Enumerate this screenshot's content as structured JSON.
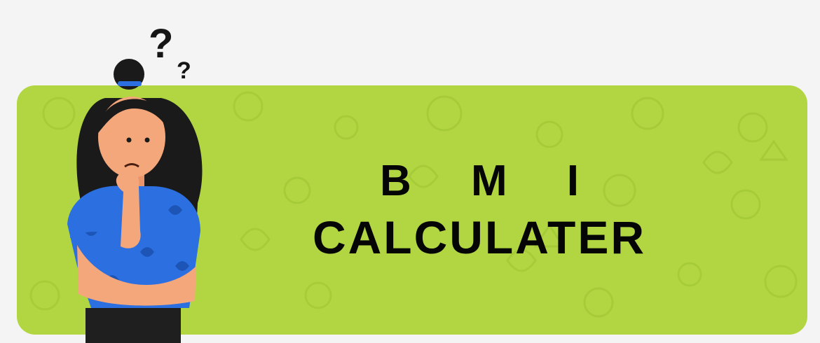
{
  "heading": {
    "line1": "B M I",
    "line2": "CALCULATER"
  },
  "colors": {
    "page_background": "#f4f4f4",
    "banner_background": "#b2d641",
    "pattern": "#a5cb36",
    "text": "#050505",
    "shirt": "#2b6fe0",
    "hair": "#1a1a1a",
    "skin": "#f4a77a"
  },
  "icons": [
    "question-mark-icon",
    "thinking-woman-illustration",
    "fruit-vegetable-pattern"
  ]
}
